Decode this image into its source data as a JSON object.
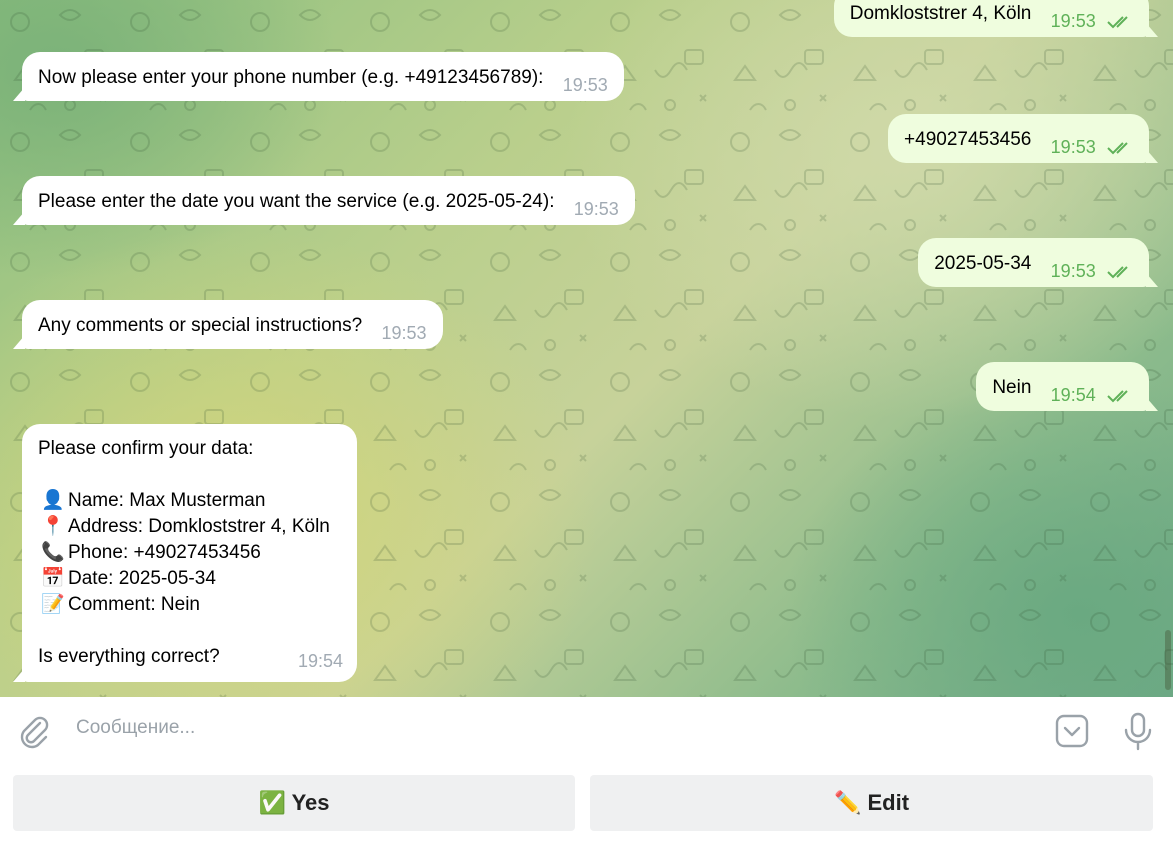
{
  "messages": {
    "out_address": {
      "text": "Domkloststrer 4, Köln",
      "time": "19:53"
    },
    "in_phone": {
      "text": "Now please enter your phone number (e.g. +49123456789):",
      "time": "19:53"
    },
    "out_phone": {
      "text": "+49027453456",
      "time": "19:53"
    },
    "in_date": {
      "text": "Please enter the date you want the service (e.g. 2025-05-24):",
      "time": "19:53"
    },
    "out_date": {
      "text": "2025-05-34",
      "time": "19:53"
    },
    "in_comments": {
      "text": "Any comments or special instructions?",
      "time": "19:53"
    },
    "out_comment": {
      "text": "Nein",
      "time": "19:54"
    },
    "confirm": {
      "header": "Please confirm your data:",
      "name": "Name: Max Musterman",
      "address": "Address: Domkloststrer 4, Köln",
      "phone": "Phone: +49027453456",
      "date": "Date: 2025-05-34",
      "comment": "Comment: Nein",
      "question": "Is everything correct?",
      "time": "19:54",
      "emoji": {
        "name": "👤",
        "address": "📍",
        "phone": "📞",
        "date": "📅",
        "comment": "📝"
      }
    }
  },
  "input": {
    "placeholder": "Сообщение..."
  },
  "keyboard": {
    "yes": "✅ Yes",
    "edit": "✏️ Edit"
  },
  "colors": {
    "incoming_bubble": "#ffffff",
    "outgoing_bubble": "#effdde",
    "outgoing_time": "#5fb158",
    "incoming_time": "#a1aab3"
  },
  "icons": [
    "attach-icon",
    "sticker-icon",
    "microphone-icon",
    "double-check-icon"
  ]
}
